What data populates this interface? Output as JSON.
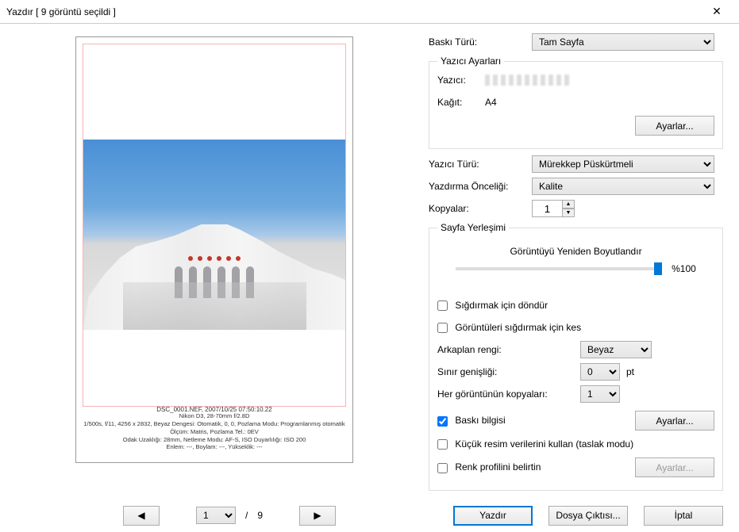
{
  "window": {
    "title": "Yazdır [ 9 görüntü seçildi ]"
  },
  "preview": {
    "caption": "DSC_0001.NEF, 2007/10/25 07:50:10.22",
    "meta1": "Nikon D3, 28-70mm f/2.8D",
    "meta2": "1/500s, f/11, 4256 x 2832, Beyaz Dengesi: Otomatik, 0, 0, Pozlama Modu: Programlanmış otomatik",
    "meta3": "Ölçüm: Matris, Pozlama Tel.: 0EV",
    "meta4": "Odak Uzaklığı: 28mm, Netleme Modu: AF-S, ISO Duyarlılığı: ISO 200",
    "meta5": "Enlem: ---, Boylam: ---, Yükseklik: ---"
  },
  "settings": {
    "printTypeLabel": "Baskı Türü:",
    "printType": "Tam Sayfa",
    "printerSettingsLegend": "Yazıcı Ayarları",
    "printerLabel": "Yazıcı:",
    "paperLabel": "Kağıt:",
    "paper": "A4",
    "settingsBtn": "Ayarlar...",
    "printerTypeLabel": "Yazıcı Türü:",
    "printerType": "Mürekkep Püskürtmeli",
    "priorityLabel": "Yazdırma Önceliği:",
    "priority": "Kalite",
    "copiesLabel": "Kopyalar:",
    "copies": "1",
    "layoutLegend": "Sayfa Yerleşimi",
    "resizeLabel": "Görüntüyü Yeniden Boyutlandır",
    "resizeValue": "%100",
    "rotateToFit": "Sığdırmak için döndür",
    "cropToFit": "Görüntüleri sığdırmak için kes",
    "bgColorLabel": "Arkaplan rengi:",
    "bgColor": "Beyaz",
    "borderWidthLabel": "Sınır genişliği:",
    "borderWidth": "0",
    "borderUnit": "pt",
    "copiesPerLabel": "Her görüntünün kopyaları:",
    "copiesPer": "1",
    "printInfo": "Baskı bilgisi",
    "useThumbs": "Küçük resim verilerini kullan (taslak modu)",
    "colorProfile": "Renk profilini belirtin"
  },
  "pager": {
    "current": "1",
    "total": "9"
  },
  "footer": {
    "print": "Yazdır",
    "fileOut": "Dosya Çıktısı...",
    "cancel": "İptal"
  }
}
